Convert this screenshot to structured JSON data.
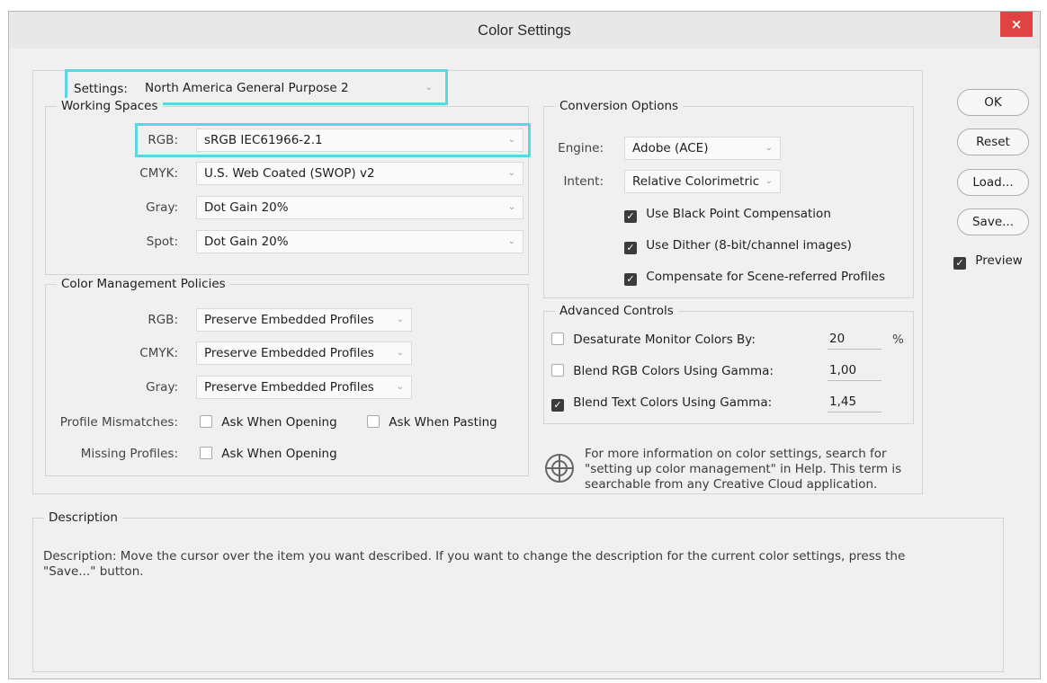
{
  "window": {
    "title": "Color Settings",
    "close": "×"
  },
  "settings": {
    "label": "Settings:",
    "value": "North America General Purpose 2"
  },
  "working_spaces": {
    "title": "Working Spaces",
    "rgb": {
      "label": "RGB:",
      "value": "sRGB IEC61966-2.1"
    },
    "cmyk": {
      "label": "CMYK:",
      "value": "U.S. Web Coated (SWOP) v2"
    },
    "gray": {
      "label": "Gray:",
      "value": "Dot Gain 20%"
    },
    "spot": {
      "label": "Spot:",
      "value": "Dot Gain 20%"
    }
  },
  "policies": {
    "title": "Color Management Policies",
    "rgb": {
      "label": "RGB:",
      "value": "Preserve Embedded Profiles"
    },
    "cmyk": {
      "label": "CMYK:",
      "value": "Preserve Embedded Profiles"
    },
    "gray": {
      "label": "Gray:",
      "value": "Preserve Embedded Profiles"
    },
    "mismatch_label": "Profile Mismatches:",
    "ask_opening": {
      "label": "Ask When Opening",
      "checked": false
    },
    "ask_pasting": {
      "label": "Ask When Pasting",
      "checked": false
    },
    "missing_label": "Missing Profiles:",
    "missing_ask_opening": {
      "label": "Ask When Opening",
      "checked": false
    }
  },
  "conversion": {
    "title": "Conversion Options",
    "engine": {
      "label": "Engine:",
      "value": "Adobe (ACE)"
    },
    "intent": {
      "label": "Intent:",
      "value": "Relative Colorimetric"
    },
    "black_point": {
      "label": "Use Black Point Compensation",
      "checked": true
    },
    "dither": {
      "label": "Use Dither (8-bit/channel images)",
      "checked": true
    },
    "scene_referred": {
      "label": "Compensate for Scene-referred Profiles",
      "checked": true
    }
  },
  "advanced": {
    "title": "Advanced Controls",
    "desaturate": {
      "label": "Desaturate Monitor Colors By:",
      "value": "20",
      "unit": "%",
      "checked": false
    },
    "blend_rgb": {
      "label": "Blend RGB Colors Using Gamma:",
      "value": "1,00",
      "checked": false
    },
    "blend_text": {
      "label": "Blend Text Colors Using Gamma:",
      "value": "1,45",
      "checked": true
    }
  },
  "info_text": "For more information on color settings, search for \"setting up color management\" in Help. This term is searchable from any Creative Cloud application.",
  "buttons": {
    "ok": "OK",
    "reset": "Reset",
    "load": "Load...",
    "save": "Save..."
  },
  "preview": {
    "label": "Preview",
    "checked": true
  },
  "description": {
    "title": "Description",
    "text": "Description: Move the cursor over the item you want described. If you want to change the description for the current color settings, press the \"Save...\" button."
  },
  "icons": {
    "checkbox_checked": "✓",
    "chevron": "⌄"
  },
  "colors": {
    "highlight": "#5ad6e6",
    "close_button": "#e04343"
  }
}
